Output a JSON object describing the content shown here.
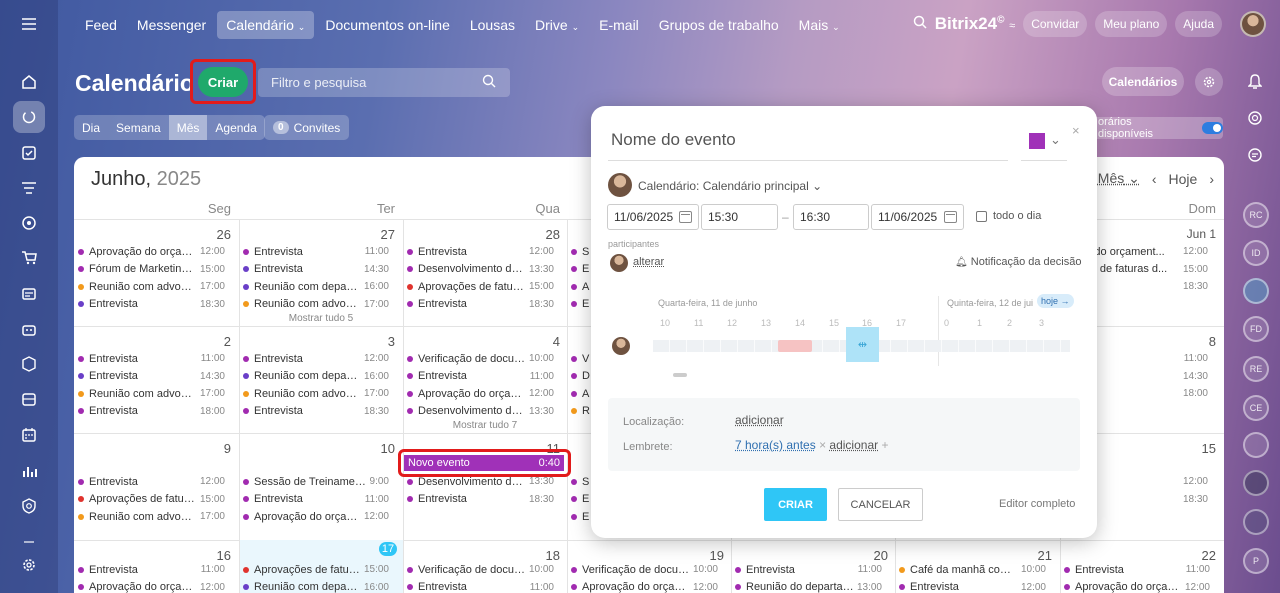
{
  "top_nav": {
    "items": [
      "Feed",
      "Messenger",
      "Calendário",
      "Documentos on-line",
      "Lousas",
      "Drive",
      "E-mail",
      "Grupos de trabalho",
      "Mais"
    ],
    "active": "Calendário",
    "brand": "Bitrix24",
    "brand_badge": "©",
    "invite": "Convidar",
    "plan": "Meu plano",
    "help": "Ajuda"
  },
  "page": {
    "title": "Calendário",
    "create_button": "Criar",
    "search_placeholder": "Filtro e pesquisa",
    "calendars_button": "Calendários",
    "available_hours": "orários disponíveis"
  },
  "view_tabs": [
    "Dia",
    "Semana",
    "Mês",
    "Agenda"
  ],
  "active_view": "Mês",
  "invites": {
    "count": "0",
    "label": "Convites"
  },
  "calendar": {
    "month": "Junho,",
    "year": "2025",
    "view_select": "Mês",
    "today": "Hoje",
    "weekdays": [
      "Seg",
      "Ter",
      "Qua",
      "Dom"
    ],
    "day_numbers": {
      "r1": [
        "26",
        "27",
        "28",
        "Jun 1"
      ],
      "r2": [
        "2",
        "3",
        "4",
        "8"
      ],
      "r3": [
        "9",
        "10",
        "11",
        "15"
      ],
      "r4": [
        "16",
        "17",
        "18",
        "19",
        "20",
        "21",
        "22"
      ]
    },
    "new_event": {
      "title": "Novo evento",
      "time": "0:40"
    }
  },
  "events": {
    "r1": [
      {
        "title": "Aprovação do orçament...",
        "time": "12:00",
        "color": "#a12bb0"
      },
      {
        "title": "Fórum de Marketing Di...",
        "time": "15:00",
        "color": "#a12bb0"
      },
      {
        "title": "Reunião com advogados",
        "time": "17:00",
        "color": "#f29a1c"
      },
      {
        "title": "Entrevista",
        "time": "18:30",
        "color": "#6a3fc8"
      },
      {
        "title": "Entrevista",
        "time": "11:00",
        "color": "#a12bb0"
      },
      {
        "title": "Entrevista",
        "time": "14:30",
        "color": "#6a3fc8"
      },
      {
        "title": "Reunião com departam...",
        "time": "16:00",
        "color": "#6a3fc8"
      },
      {
        "title": "Reunião com advogados",
        "time": "17:00",
        "color": "#f29a1c"
      },
      {
        "title": "Entrevista",
        "time": "12:00",
        "color": "#a12bb0"
      },
      {
        "title": "Desenvolvimento de do...",
        "time": "13:30",
        "color": "#a12bb0"
      },
      {
        "title": "Aprovações de faturas d...",
        "time": "15:00",
        "color": "#e0332e"
      },
      {
        "title": "Entrevista",
        "time": "18:30",
        "color": "#a12bb0"
      },
      {
        "title": "Se",
        "time": "",
        "color": "#a12bb0"
      },
      {
        "title": "En",
        "time": "",
        "color": "#a12bb0"
      },
      {
        "title": "Ap",
        "time": "",
        "color": "#a12bb0"
      },
      {
        "title": "En",
        "time": "",
        "color": "#a12bb0"
      },
      {
        "title": "vação do orçament...",
        "time": "12:00",
        "color": ""
      },
      {
        "title": "vações de faturas d...",
        "time": "15:00",
        "color": ""
      },
      {
        "title": "vista",
        "time": "18:30",
        "color": ""
      }
    ],
    "r1_more": "Mostrar tudo 5",
    "r2": [
      {
        "title": "Entrevista",
        "time": "11:00",
        "color": "#a12bb0"
      },
      {
        "title": "Entrevista",
        "time": "14:30",
        "color": "#6a3fc8"
      },
      {
        "title": "Reunião com advogados",
        "time": "17:00",
        "color": "#f29a1c"
      },
      {
        "title": "Entrevista",
        "time": "18:00",
        "color": "#a12bb0"
      },
      {
        "title": "Entrevista",
        "time": "12:00",
        "color": "#a12bb0"
      },
      {
        "title": "Reunião com departam...",
        "time": "16:00",
        "color": "#6a3fc8"
      },
      {
        "title": "Reunião com advogados",
        "time": "17:00",
        "color": "#f29a1c"
      },
      {
        "title": "Entrevista",
        "time": "18:30",
        "color": "#a12bb0"
      },
      {
        "title": "Verificação de documen...",
        "time": "10:00",
        "color": "#a12bb0"
      },
      {
        "title": "Entrevista",
        "time": "11:00",
        "color": "#a12bb0"
      },
      {
        "title": "Aprovação do orçament...",
        "time": "12:00",
        "color": "#a12bb0"
      },
      {
        "title": "Desenvolvimento de do...",
        "time": "13:30",
        "color": "#a12bb0"
      },
      {
        "title": "Ve",
        "time": "",
        "color": "#a12bb0"
      },
      {
        "title": "De",
        "time": "",
        "color": "#a12bb0"
      },
      {
        "title": "Ap",
        "time": "",
        "color": "#a12bb0"
      },
      {
        "title": "Re",
        "time": "",
        "color": "#f29a1c"
      },
      {
        "title": "vista",
        "time": "11:00",
        "color": ""
      },
      {
        "title": "vista",
        "time": "14:30",
        "color": ""
      },
      {
        "title": "vista",
        "time": "18:00",
        "color": ""
      }
    ],
    "r2_more": "Mostrar tudo 7",
    "r3": [
      {
        "title": "Entrevista",
        "time": "12:00",
        "color": "#a12bb0"
      },
      {
        "title": "Aprovações de faturas d...",
        "time": "15:00",
        "color": "#e0332e"
      },
      {
        "title": "Reunião com advogados",
        "time": "17:00",
        "color": "#f29a1c"
      },
      {
        "title": "Sessão de Treinamento d...",
        "time": "9:00",
        "color": "#a12bb0"
      },
      {
        "title": "Entrevista",
        "time": "11:00",
        "color": "#a12bb0"
      },
      {
        "title": "Aprovação do orçament...",
        "time": "12:00",
        "color": "#a12bb0"
      },
      {
        "title": "Desenvolvimento de do...",
        "time": "13:30",
        "color": "#a12bb0"
      },
      {
        "title": "Entrevista",
        "time": "18:30",
        "color": "#a12bb0"
      },
      {
        "title": "Se",
        "time": "",
        "color": "#a12bb0"
      },
      {
        "title": "En",
        "time": "",
        "color": "#a12bb0"
      },
      {
        "title": "En",
        "time": "",
        "color": "#a12bb0"
      },
      {
        "title": "vista",
        "time": "12:00",
        "color": ""
      },
      {
        "title": "vista",
        "time": "18:30",
        "color": ""
      }
    ],
    "r4": [
      {
        "title": "Entrevista",
        "time": "11:00",
        "color": "#a12bb0"
      },
      {
        "title": "Aprovação do orçament...",
        "time": "12:00",
        "color": "#a12bb0"
      },
      {
        "title": "Aprovações de faturas d...",
        "time": "15:00",
        "color": "#e0332e"
      },
      {
        "title": "Reunião com departam...",
        "time": "16:00",
        "color": "#6a3fc8"
      },
      {
        "title": "Verificação de documen...",
        "time": "10:00",
        "color": "#a12bb0"
      },
      {
        "title": "Entrevista",
        "time": "11:00",
        "color": "#a12bb0"
      },
      {
        "title": "Verificação de documen...",
        "time": "10:00",
        "color": "#a12bb0"
      },
      {
        "title": "Aprovação do orçament...",
        "time": "12:00",
        "color": "#a12bb0"
      },
      {
        "title": "Entrevista",
        "time": "11:00",
        "color": "#a12bb0"
      },
      {
        "title": "Reunião do departamen...",
        "time": "13:00",
        "color": "#a12bb0"
      },
      {
        "title": "Café da manhã com me...",
        "time": "10:00",
        "color": "#f29a1c"
      },
      {
        "title": "Entrevista",
        "time": "12:00",
        "color": "#a12bb0"
      },
      {
        "title": "Entrevista",
        "time": "11:00",
        "color": "#a12bb0"
      },
      {
        "title": "Aprovação do orçament...",
        "time": "12:00",
        "color": "#a12bb0"
      }
    ]
  },
  "popup": {
    "title_placeholder": "Nome do evento",
    "event_color": "#a031b8",
    "calendar_label": "Calendário: Calendário principal",
    "date_from": "11/06/2025",
    "time_from": "15:30",
    "sep": "–",
    "time_to": "16:30",
    "date_to": "11/06/2025",
    "all_day": "todo o dia",
    "participants_label": "participantes",
    "change": "alterar",
    "decision_notify": "Notificação da decisão",
    "day1": "Quarta-feira, 11 de junho",
    "day2": "Quinta-feira, 12 de jui",
    "today_tag": "hoje →",
    "hours1": [
      "10",
      "11",
      "12",
      "13",
      "14",
      "15",
      "16",
      "17"
    ],
    "hours2": [
      "0",
      "1",
      "2",
      "3"
    ],
    "location_label": "Localização:",
    "location_value": "adicionar",
    "reminder_label": "Lembrete:",
    "reminder_value": "7 hora(s) antes",
    "reminder_add": "adicionar",
    "create": "CRIAR",
    "cancel": "CANCELAR",
    "full_editor": "Editor completo"
  },
  "right_sidebar_avatars": [
    "RC",
    "ID",
    "FD",
    "RE",
    "CE",
    "P"
  ]
}
